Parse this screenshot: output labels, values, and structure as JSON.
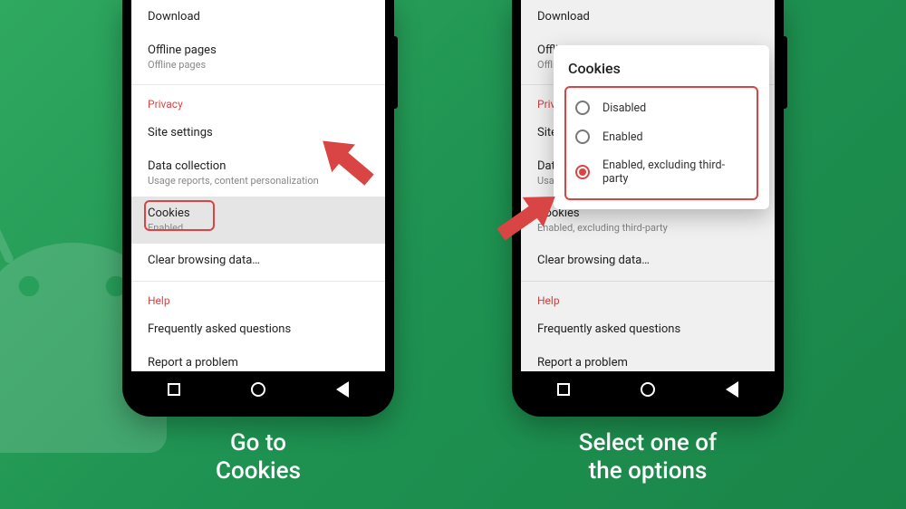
{
  "captions": {
    "left": "Go to\nCookies",
    "right": "Select one of\nthe options"
  },
  "settings": {
    "download": "Download",
    "offline_pages": {
      "title": "Offline pages",
      "sub": "Offline pages"
    },
    "privacy_header": "Privacy",
    "site_settings": "Site settings",
    "data_collection": {
      "title": "Data collection",
      "sub": "Usage reports, content personalization"
    },
    "cookies": {
      "title": "Cookies",
      "sub": "Enabled"
    },
    "cookies_right_sub": "Enabled, excluding third-party",
    "clear_browsing": "Clear browsing data…",
    "help_header": "Help",
    "faq": "Frequently asked questions",
    "report": "Report a problem"
  },
  "dialog": {
    "title": "Cookies",
    "options": [
      "Disabled",
      "Enabled",
      "Enabled, excluding third-party"
    ],
    "selected_index": 2
  }
}
